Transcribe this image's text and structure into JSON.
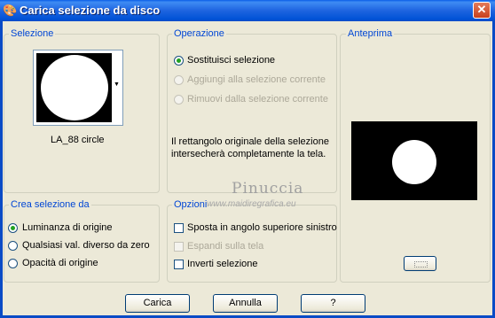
{
  "window": {
    "title": "Carica selezione da disco",
    "close_glyph": "✕"
  },
  "selezione": {
    "legend": "Selezione",
    "selected_name": "LA_88 circle"
  },
  "operazione": {
    "legend": "Operazione",
    "options": [
      {
        "label": "Sostituisci selezione",
        "checked": true,
        "enabled": true
      },
      {
        "label": "Aggiungi alla selezione corrente",
        "checked": false,
        "enabled": false
      },
      {
        "label": "Rimuovi dalla selezione corrente",
        "checked": false,
        "enabled": false
      }
    ],
    "info_text_line1": "Il rettangolo originale della selezione",
    "info_text_line2": "intersecherà completamente la tela."
  },
  "anteprima": {
    "legend": "Anteprima"
  },
  "crea": {
    "legend": "Crea selezione da",
    "options": [
      {
        "label": "Luminanza di origine",
        "checked": true
      },
      {
        "label": "Qualsiasi val. diverso da zero",
        "checked": false
      },
      {
        "label": "Opacità di origine",
        "checked": false
      }
    ]
  },
  "opzioni": {
    "legend": "Opzioni",
    "options": [
      {
        "label": "Sposta in angolo superiore sinistro",
        "checked": false,
        "enabled": true
      },
      {
        "label": "Espandi sulla tela",
        "checked": false,
        "enabled": false
      },
      {
        "label": "Inverti selezione",
        "checked": false,
        "enabled": true
      }
    ]
  },
  "watermark": {
    "name": "Pinuccia",
    "url": "www.maidiregrafica.eu"
  },
  "buttons": {
    "carica": "Carica",
    "annulla": "Annulla",
    "help": "?"
  }
}
